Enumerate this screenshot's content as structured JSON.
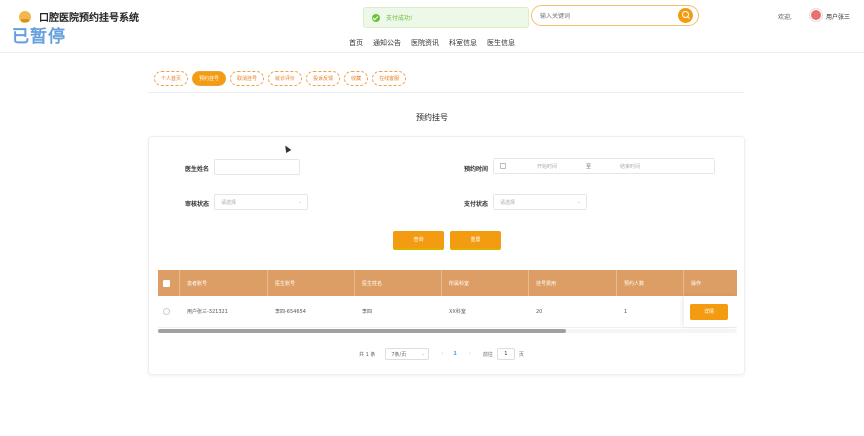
{
  "site": {
    "title": "口腔医院预约挂号系统",
    "watermark": "已暂停"
  },
  "toast": {
    "text": "支付成功!"
  },
  "search": {
    "placeholder": "输入关键词"
  },
  "user": {
    "welcome": "欢迎,",
    "name": "用户张三"
  },
  "nav": [
    "首页",
    "通知公告",
    "医院资讯",
    "科室信息",
    "医生信息"
  ],
  "subtabs": [
    {
      "label": "个人首页",
      "active": false
    },
    {
      "label": "预约挂号",
      "active": true
    },
    {
      "label": "取消挂号",
      "active": false
    },
    {
      "label": "就诊评价",
      "active": false
    },
    {
      "label": "投诉反馈",
      "active": false
    },
    {
      "label": "收藏",
      "active": false
    },
    {
      "label": "在线客服",
      "active": false
    }
  ],
  "page_title": "预约挂号",
  "filters": {
    "doctor_label": "医生姓名",
    "time_label": "预约时间",
    "start_ph": "开始时间",
    "range_sep": "至",
    "end_ph": "结束时间",
    "audit_label": "审核状态",
    "audit_ph": "请选择",
    "pay_label": "支付状态",
    "pay_ph": "请选择"
  },
  "buttons": {
    "query": "查询",
    "reset": "重置"
  },
  "table": {
    "headers": [
      "患者账号",
      "医生账号",
      "医生姓名",
      "所属科室",
      "挂号费用",
      "预约人数",
      "操作"
    ],
    "rows": [
      {
        "patient": "用户张三-321321",
        "doctor_account": "李四-654654",
        "doctor_name": "李四",
        "department": "XX科室",
        "fee": "20",
        "count": "1",
        "action": "详情"
      }
    ]
  },
  "pagination": {
    "total": "共 1 条",
    "page_size": "7条/页",
    "prev": "‹",
    "current": "1",
    "next": "›",
    "goto": "前往",
    "jump_value": "1",
    "unit": "页"
  },
  "colors": {
    "accent": "#f39c12",
    "table_header": "#dc9e64",
    "success": "#67c23a"
  }
}
